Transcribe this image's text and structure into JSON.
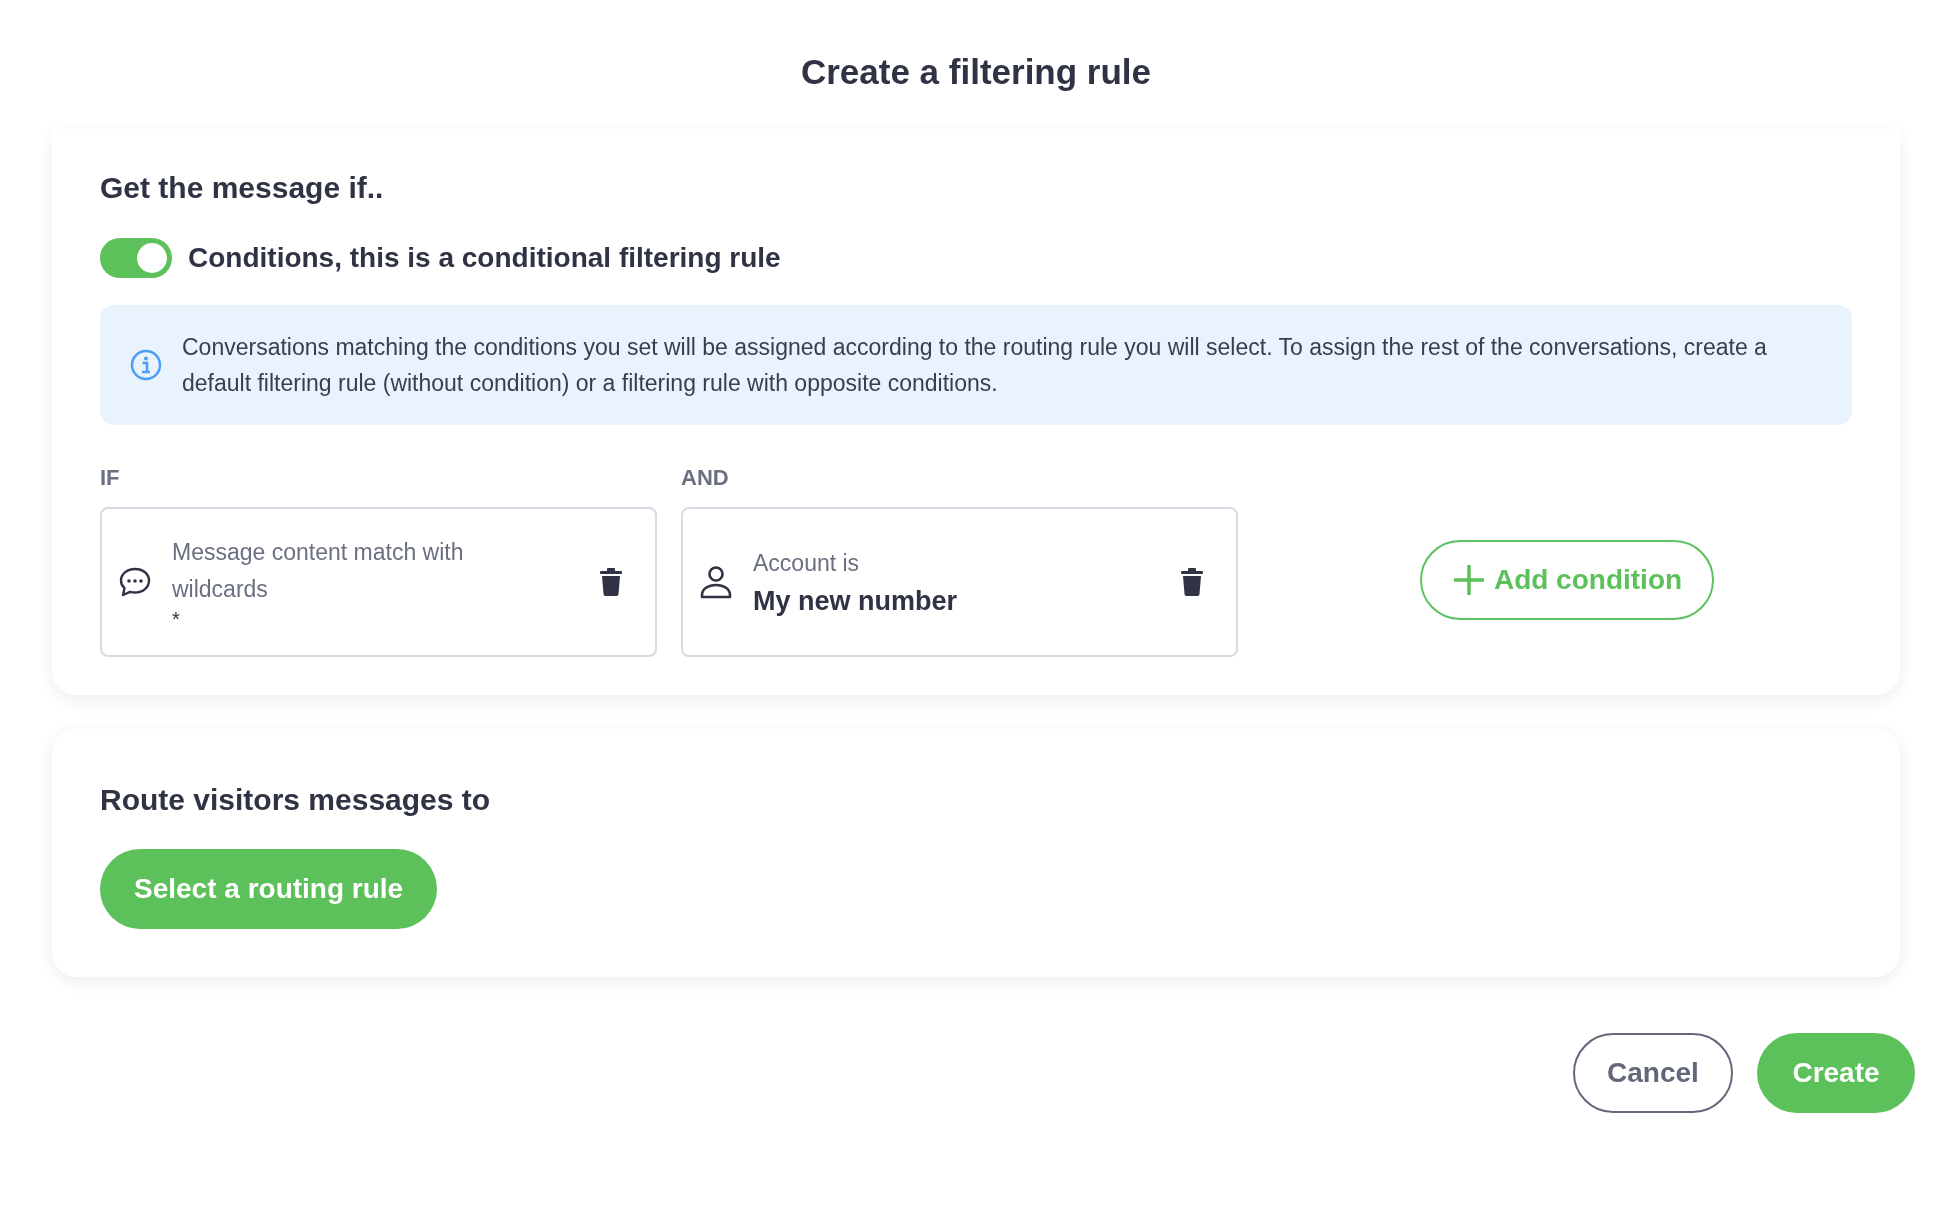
{
  "title": "Create a filtering rule",
  "conditions_section": {
    "heading": "Get the message if..",
    "toggle": {
      "label": "Conditions, this is a conditional filtering rule",
      "on": true
    },
    "info": "Conversations matching the conditions you set will be assigned according to the routing rule you will select. To assign the rest of the conversations, create a default filtering rule (without condition) or a filtering rule with opposite conditions.",
    "conditions": [
      {
        "kind": "message",
        "label": "IF",
        "title": "Message content match with wildcards",
        "value": "*"
      },
      {
        "kind": "account",
        "label": "AND",
        "title": "Account is",
        "value": "My new number"
      }
    ],
    "add_button": "Add condition"
  },
  "route_section": {
    "heading": "Route visitors messages to",
    "button": "Select a routing rule"
  },
  "footer": {
    "cancel": "Cancel",
    "create": "Create"
  }
}
